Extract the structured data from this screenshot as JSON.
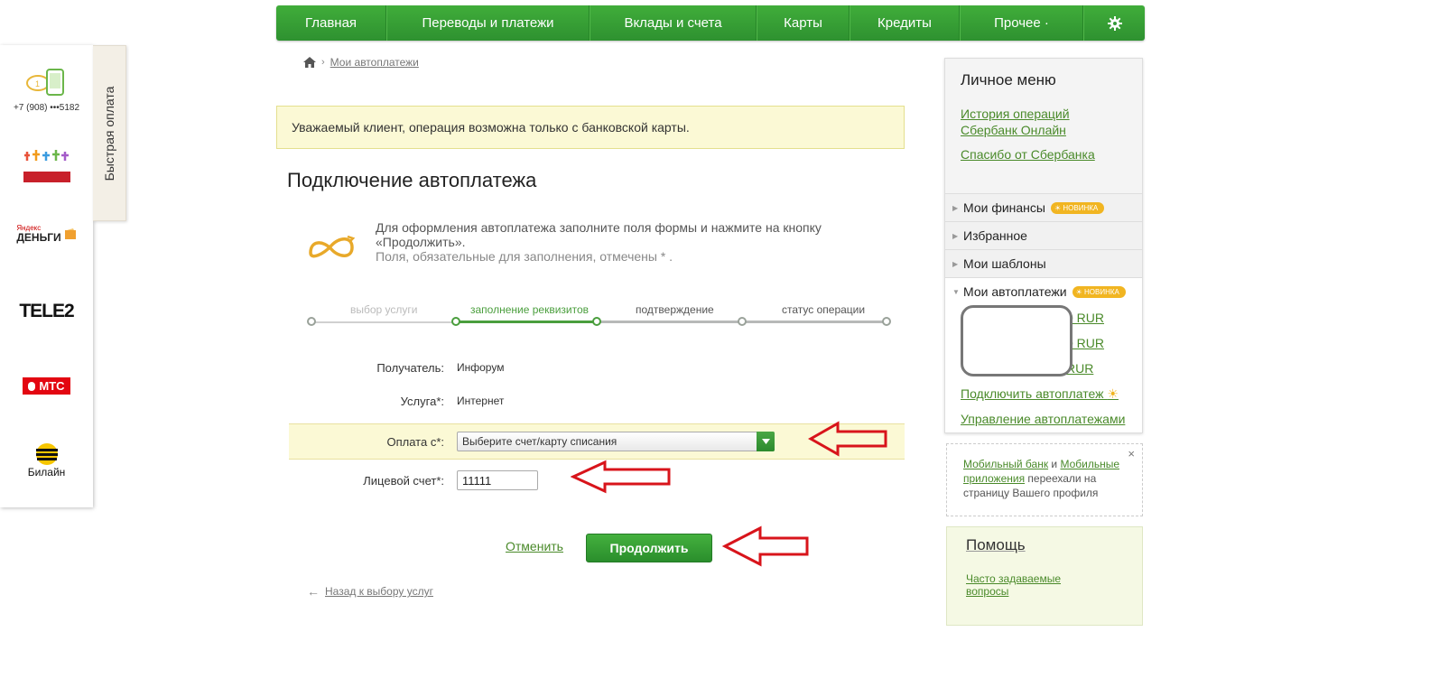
{
  "nav": {
    "items": [
      "Главная",
      "Переводы и платежи",
      "Вклады и счета",
      "Карты",
      "Кредиты",
      "Прочее ·"
    ],
    "settings_icon": "gear-icon"
  },
  "quick_pay": {
    "tab_label": "Быстрая оплата",
    "phone": "+7 (908) •••5182",
    "providers": {
      "yandex_line1": "Яндекс",
      "yandex_line2": "ДЕНЬГИ",
      "tele2": "TELE2",
      "mts": "МТС",
      "beeline": "Билайн"
    }
  },
  "breadcrumb": {
    "home_icon": "home-icon",
    "link": "Мои автоплатежи"
  },
  "notice": "Уважаемый клиент, операция возможна только с банковской карты.",
  "title": "Подключение автоплатежа",
  "intro": {
    "text": "Для оформления автоплатежа заполните поля формы и нажмите на кнопку «Продолжить».",
    "required": "Поля, обязательные для заполнения, отмечены * ."
  },
  "steps": [
    "выбор услуги",
    "заполнение реквизитов",
    "подтверждение",
    "статус операции"
  ],
  "form": {
    "recipient_label": "Получатель:",
    "recipient_value": "Инфорум",
    "service_label": "Услуга*:",
    "service_value": "Интернет",
    "payfrom_label": "Оплата с*:",
    "payfrom_value": "Выберите счет/карту списания",
    "account_label": "Лицевой счет*:",
    "account_value": "11111"
  },
  "actions": {
    "cancel": "Отменить",
    "continue": "Продолжить",
    "back": "Назад к выбору услуг"
  },
  "personal_menu": {
    "title": "Личное меню",
    "links": [
      "История операций Сбербанк Онлайн",
      "Спасибо от Сбербанка"
    ],
    "sections": [
      {
        "label": "Мои финансы",
        "badge": "НОВИНКА"
      },
      {
        "label": "Избранное"
      },
      {
        "label": "Мои шаблоны"
      }
    ],
    "autopay": {
      "label": "Мои автоплатежи",
      "badge": "НОВИНКА",
      "amounts": [
        "0 RUR",
        "0 RUR",
        "RUR"
      ],
      "connect": "Подключить автоплатеж",
      "manage": "Управление автоплатежами"
    }
  },
  "mobile_notice": {
    "link1": "Мобильный банк",
    "and": " и ",
    "link2": "Мобильные приложения",
    "rest": " переехали на страницу Вашего профиля",
    "close": "×"
  },
  "help": {
    "title": "Помощь",
    "link": "Часто задаваемые вопросы"
  },
  "colors": {
    "brand_green": "#2e9130",
    "link_green": "#4a8a2a",
    "notice_bg": "#fbf9d5",
    "arrow_red": "#d8141b",
    "badge": "#f1b521"
  }
}
